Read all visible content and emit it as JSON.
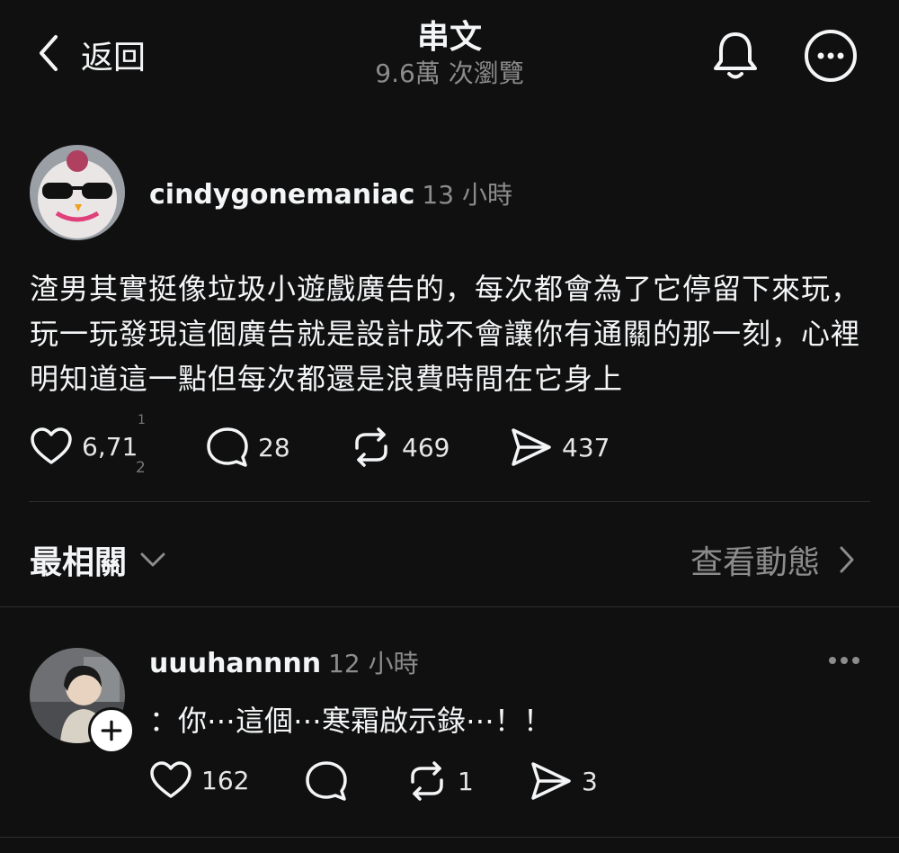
{
  "header": {
    "back_label": "返回",
    "title": "串文",
    "views": "9.6萬 次瀏覽"
  },
  "post": {
    "username": "cindygonemaniac",
    "time": "13 小時",
    "text": "渣男其實挺像垃圾小遊戲廣告的，每次都會為了它停留下來玩，玩一玩發現這個廣告就是設計成不會讓你有通關的那一刻，心裡明知道這一點但每次都還是浪費時間在它身上",
    "likes": "6,71",
    "likes_tail_top": "1",
    "likes_tail_bottom": "2",
    "comments": "28",
    "reposts": "469",
    "shares": "437"
  },
  "section": {
    "title": "最相關",
    "activity_label": "查看動態"
  },
  "reply": {
    "username": "uuuhannnn",
    "time": "12 小時",
    "text": "：你⋯這個⋯寒霜啟示錄⋯！！",
    "likes": "162",
    "comments": "",
    "reposts": "1",
    "shares": "3"
  },
  "colors": {
    "background": "#101010",
    "text": "#f3f5f7",
    "secondary": "#8c8c8c",
    "divider": "#2e2e2e"
  },
  "icons": [
    "chevron-left-icon",
    "bell-icon",
    "more-circle-icon",
    "heart-icon",
    "comment-icon",
    "repost-icon",
    "share-icon",
    "chevron-down-icon",
    "chevron-right-icon",
    "more-dots-icon",
    "plus-icon"
  ]
}
